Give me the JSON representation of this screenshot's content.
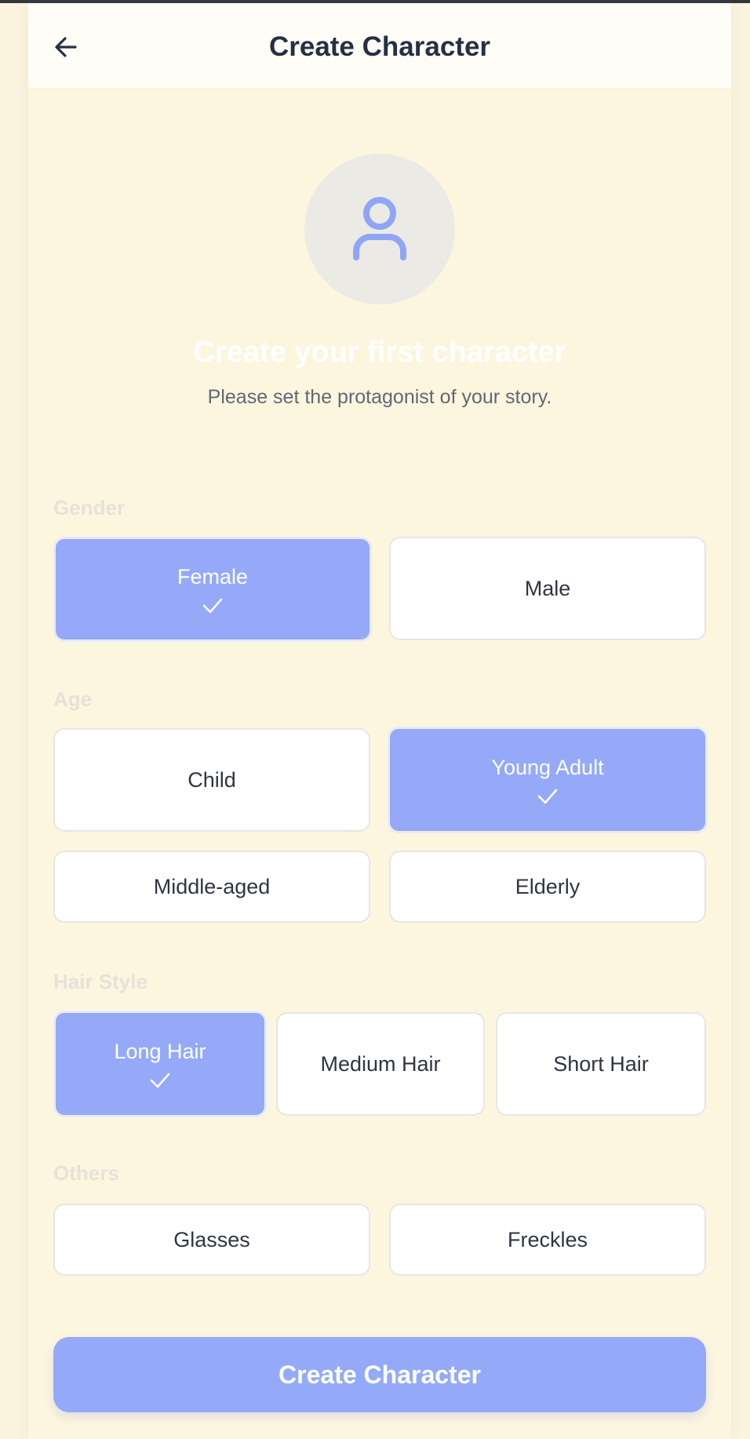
{
  "header": {
    "title": "Create Character"
  },
  "hero": {
    "title": "Create your first character",
    "subtitle": "Please set the protagonist of your story."
  },
  "sections": {
    "gender": {
      "label": "Gender",
      "options": [
        {
          "label": "Female",
          "selected": true
        },
        {
          "label": "Male",
          "selected": false
        }
      ]
    },
    "age": {
      "label": "Age",
      "options": [
        {
          "label": "Child",
          "selected": false
        },
        {
          "label": "Young Adult",
          "selected": true
        },
        {
          "label": "Middle-aged",
          "selected": false
        },
        {
          "label": "Elderly",
          "selected": false
        }
      ]
    },
    "hair": {
      "label": "Hair Style",
      "options": [
        {
          "label": "Long Hair",
          "selected": true
        },
        {
          "label": "Medium Hair",
          "selected": false
        },
        {
          "label": "Short Hair",
          "selected": false
        }
      ]
    },
    "others": {
      "label": "Others",
      "options": [
        {
          "label": "Glasses",
          "selected": false
        },
        {
          "label": "Freckles",
          "selected": false
        }
      ]
    }
  },
  "cta": {
    "label": "Create Character"
  },
  "colors": {
    "background": "#fdf6df",
    "accent": "#94aaf8",
    "title_text": "#253044",
    "icon_blue": "#8fa6f6"
  },
  "icons": {
    "back": "arrow-left-icon",
    "avatar": "user-icon",
    "selected": "check-icon"
  }
}
